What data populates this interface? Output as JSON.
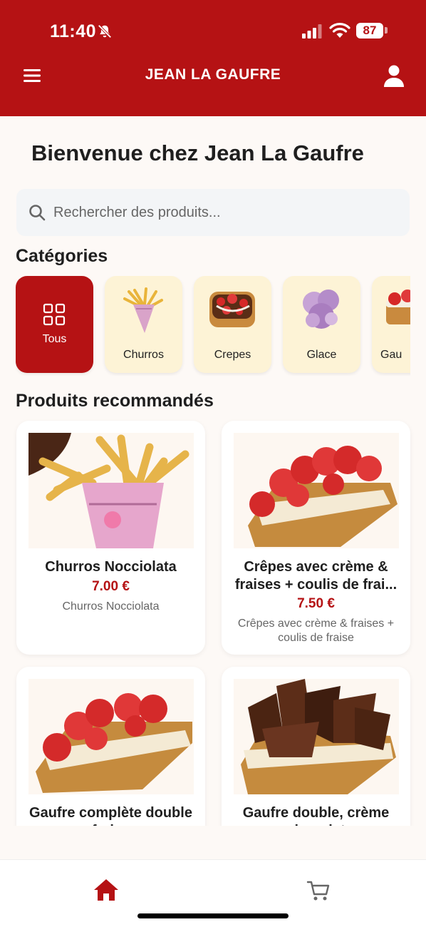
{
  "status_bar": {
    "time": "11:40",
    "battery": "87"
  },
  "header": {
    "brand": "JEAN LA GAUFRE"
  },
  "welcome": "Bienvenue chez Jean La Gaufre",
  "search": {
    "placeholder": "Rechercher des produits..."
  },
  "categories": {
    "title": "Catégories",
    "items": [
      {
        "label": "Tous",
        "selected": true
      },
      {
        "label": "Churros"
      },
      {
        "label": "Crepes"
      },
      {
        "label": "Glace"
      },
      {
        "label": "Gau"
      }
    ]
  },
  "products": {
    "title": "Produits recommandés",
    "items": [
      {
        "name": "Churros Nocciolata",
        "price": "7.00 €",
        "description": "Churros Nocciolata"
      },
      {
        "name": "Crêpes avec crème & fraises + coulis de frai...",
        "price": "7.50 €",
        "description": "Crêpes avec crème & fraises + coulis de fraise"
      },
      {
        "name": "Gaufre complète double fraise"
      },
      {
        "name": "Gaufre double, crème chocolat"
      }
    ]
  },
  "colors": {
    "brand": "#b51214",
    "category_bg": "#fdf3d6"
  },
  "icons": {
    "menu": "hamburger-icon",
    "profile": "user-icon",
    "search": "search-icon",
    "home": "home-icon",
    "cart": "cart-icon"
  }
}
